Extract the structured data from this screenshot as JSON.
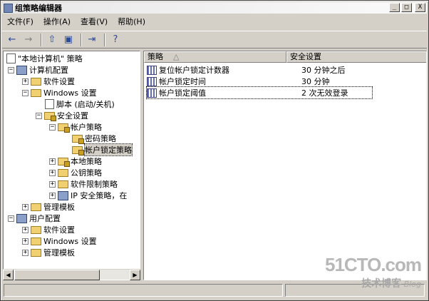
{
  "window": {
    "title": "组策略编辑器",
    "min": "_",
    "max": "□",
    "close": "X"
  },
  "menu": [
    "文件(F)",
    "操作(A)",
    "查看(V)",
    "帮助(H)"
  ],
  "toolbar": {
    "back": "←",
    "forward": "→",
    "up": "⇧",
    "show_tree": "▣",
    "export": "⇥",
    "help": "?"
  },
  "tree": [
    {
      "label": "\"本地计算机\" 策略",
      "icon": "policy-doc-icon",
      "pm": ""
    },
    {
      "label": "计算机配置",
      "icon": "computer-icon",
      "pm": "−"
    },
    {
      "label": "软件设置",
      "icon": "folder-icon",
      "pm": "+"
    },
    {
      "label": "Windows 设置",
      "icon": "folder-icon",
      "pm": "−"
    },
    {
      "label": "脚本 (启动/关机)",
      "icon": "script-icon",
      "pm": ""
    },
    {
      "label": "安全设置",
      "icon": "security-icon",
      "pm": "−"
    },
    {
      "label": "帐户策略",
      "icon": "folder-lock-icon",
      "pm": "−"
    },
    {
      "label": "密码策略",
      "icon": "folder-lock-icon",
      "pm": ""
    },
    {
      "label": "帐户锁定策略",
      "icon": "folder-lock-icon",
      "pm": ""
    },
    {
      "label": "本地策略",
      "icon": "folder-lock-icon",
      "pm": "+"
    },
    {
      "label": "公钥策略",
      "icon": "folder-icon",
      "pm": "+"
    },
    {
      "label": "软件限制策略",
      "icon": "folder-icon",
      "pm": "+"
    },
    {
      "label": "IP 安全策略，在",
      "icon": "ip-security-icon",
      "pm": "+"
    },
    {
      "label": "管理模板",
      "icon": "folder-icon",
      "pm": "+"
    },
    {
      "label": "用户配置",
      "icon": "user-icon",
      "pm": "−"
    },
    {
      "label": "软件设置",
      "icon": "folder-icon",
      "pm": "+"
    },
    {
      "label": "Windows 设置",
      "icon": "folder-icon",
      "pm": "+"
    },
    {
      "label": "管理模板",
      "icon": "folder-icon",
      "pm": "+"
    }
  ],
  "list": {
    "col_policy": "策略",
    "col_sort": "△",
    "col_setting": "安全设置",
    "rows": [
      {
        "policy": "复位帐户锁定计数器",
        "setting": "30 分钟之后"
      },
      {
        "policy": "帐户锁定时间",
        "setting": "30 分钟"
      },
      {
        "policy": "帐户锁定阈值",
        "setting": "2 次无效登录"
      }
    ]
  },
  "watermark": {
    "main": "51CTO.com",
    "sub": "技术博客",
    "blog": "Blog"
  }
}
